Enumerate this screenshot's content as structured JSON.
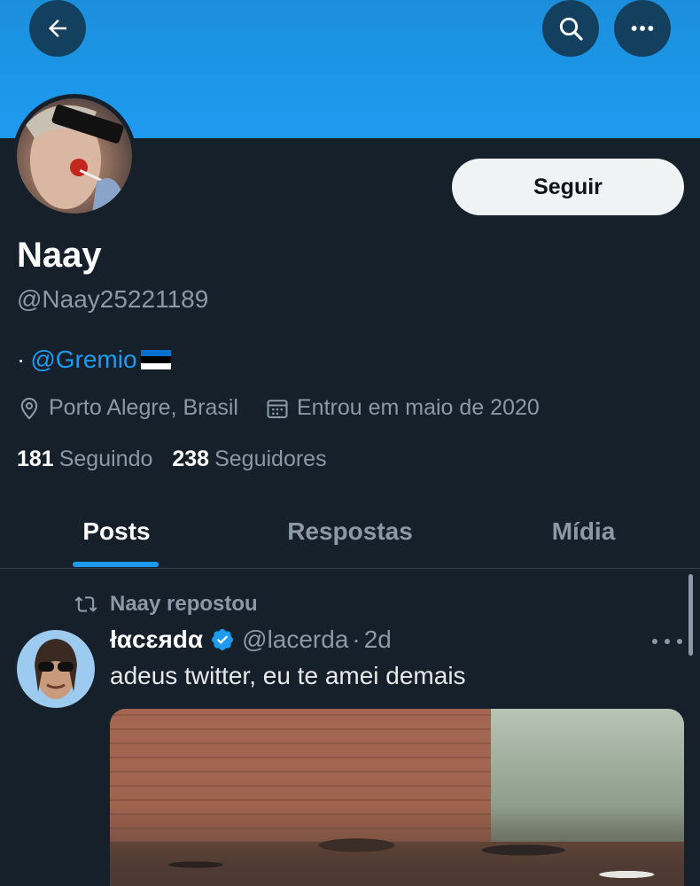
{
  "header": {
    "back_icon": "arrow-left-icon",
    "search_icon": "search-icon",
    "more_icon": "ellipsis-icon",
    "banner_color": "#1d9bf0"
  },
  "profile": {
    "name": "Naay",
    "handle": "@Naay25221189",
    "follow_label": "Seguir",
    "bio_prefix": "·",
    "bio_mention": "@Gremio",
    "bio_flag_colors": [
      "#0072ce",
      "#000000",
      "#ffffff"
    ],
    "location": "Porto Alegre, Brasil",
    "joined": "Entrou em maio de 2020",
    "following_count": "181",
    "following_label": "Seguindo",
    "followers_count": "238",
    "followers_label": "Seguidores"
  },
  "tabs": [
    {
      "label": "Posts",
      "active": true
    },
    {
      "label": "Respostas",
      "active": false
    },
    {
      "label": "Mídia",
      "active": false
    }
  ],
  "feed": {
    "repost_label": "Naay repostou",
    "tweet": {
      "display_name": "łαcɛяdα",
      "verified": true,
      "handle": "@lacerda",
      "separator": "·",
      "time": "2d",
      "text": "adeus twitter, eu te amei demais"
    }
  },
  "colors": {
    "background": "#15202b",
    "accent": "#1d9bf0",
    "muted": "#8b98a5",
    "text": "#e7e9ea"
  }
}
